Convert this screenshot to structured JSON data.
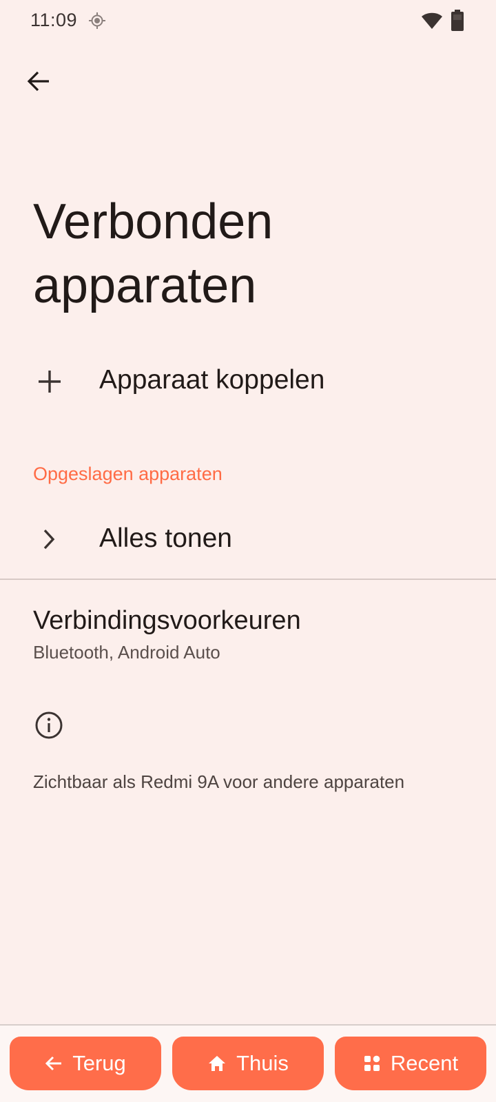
{
  "status_bar": {
    "time": "11:09",
    "icons": [
      "location-icon",
      "wifi-icon",
      "battery-icon"
    ]
  },
  "header": {
    "back_icon": "arrow-back-icon",
    "title": "Verbonden apparaten"
  },
  "pair_device": {
    "icon": "plus-icon",
    "label": "Apparaat koppelen"
  },
  "saved_devices": {
    "header": "Opgeslagen apparaten",
    "show_all": {
      "icon": "chevron-right-icon",
      "label": "Alles tonen"
    }
  },
  "connection_preferences": {
    "title": "Verbindingsvoorkeuren",
    "summary": "Bluetooth, Android Auto"
  },
  "info": {
    "icon": "info-icon",
    "text": "Zichtbaar als Redmi 9A voor andere apparaten"
  },
  "bottom_nav": {
    "back_label": "Terug",
    "home_label": "Thuis",
    "recent_label": "Recent"
  },
  "colors": {
    "background": "#fcefec",
    "accent": "#ff6b45",
    "nav_button": "#ff6d4a",
    "text_primary": "#211a18"
  }
}
